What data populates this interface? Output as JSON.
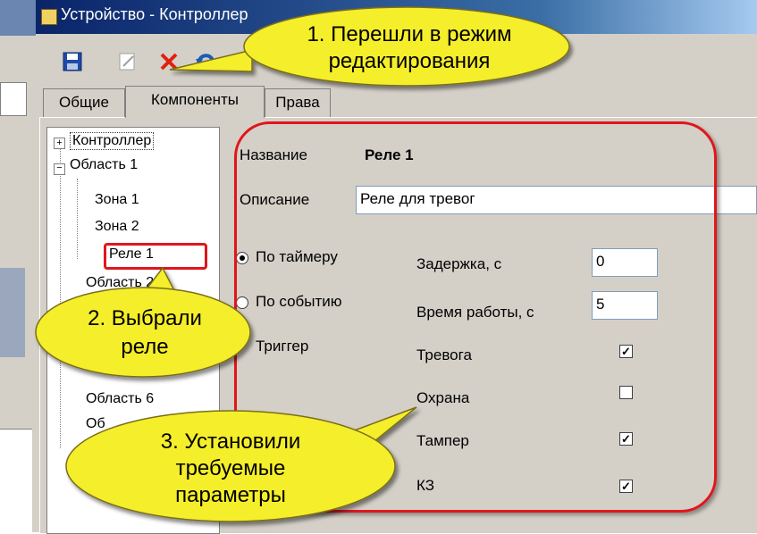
{
  "window": {
    "title": "Устройство - Контроллер"
  },
  "toolbar": {
    "icons": [
      "save-icon",
      "edit-icon",
      "delete-icon",
      "undo-icon"
    ]
  },
  "tabs": [
    {
      "label": "Общие"
    },
    {
      "label": "Компоненты"
    },
    {
      "label": "Права"
    }
  ],
  "tree": [
    {
      "label": "Контроллер",
      "expander": "+"
    },
    {
      "label": "Область 1",
      "expander": "−"
    },
    {
      "label": "Зона 1"
    },
    {
      "label": "Зона 2"
    },
    {
      "label": "Реле 1"
    },
    {
      "label": "Область 2"
    },
    {
      "label": "Область 6"
    },
    {
      "label": "Об"
    }
  ],
  "form": {
    "name_label": "Название",
    "name_value": "Реле 1",
    "desc_label": "Описание",
    "desc_value": "Реле для тревог",
    "mode_timer": "По таймеру",
    "mode_event": "По событию",
    "mode_trigger": "Триггер",
    "delay_label": "Задержка, с",
    "delay_value": "0",
    "worktime_label": "Время работы, с",
    "worktime_value": "5",
    "checks": [
      {
        "label": "Тревога",
        "checked": true
      },
      {
        "label": "Охрана",
        "checked": false
      },
      {
        "label": "Тампер",
        "checked": true
      },
      {
        "label": "КЗ",
        "checked": true
      }
    ]
  },
  "callouts": {
    "c1_line1": "1. Перешли в режим",
    "c1_line2": "редактирования",
    "c2_line1": "2. Выбрали",
    "c2_line2": "реле",
    "c3_line1": "3. Установили",
    "c3_line2": "требуемые",
    "c3_line3": "параметры"
  },
  "colors": {
    "titlebar": "#0a246a",
    "panel": "#d4d0c8",
    "highlight": "#e0161b",
    "callout": "#f5ee2a"
  }
}
